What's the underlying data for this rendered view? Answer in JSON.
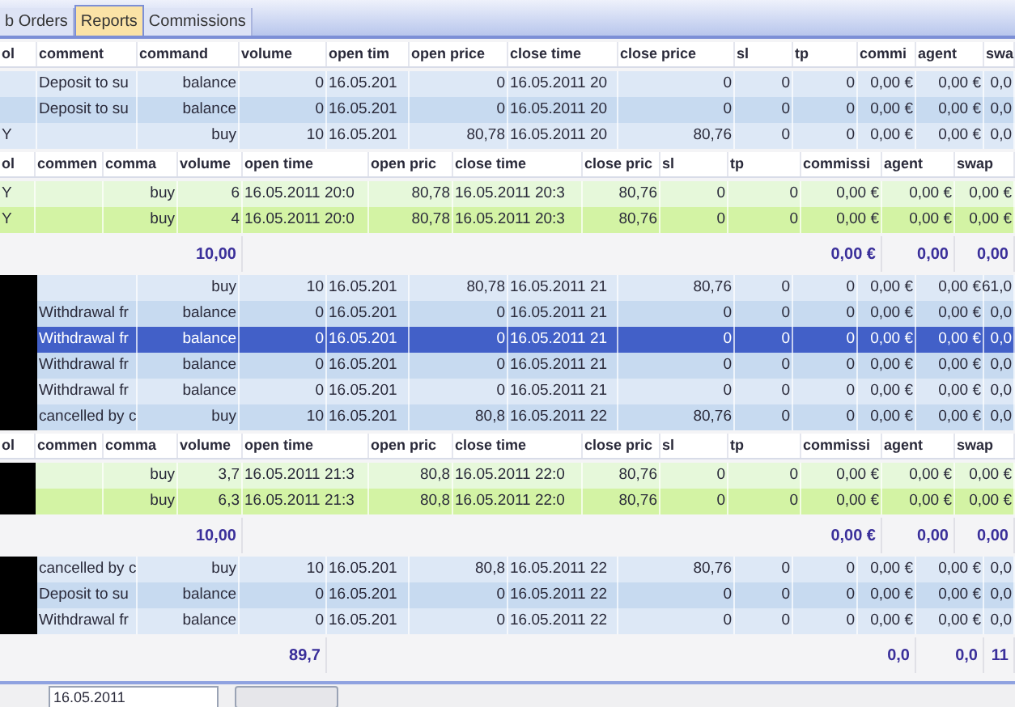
{
  "tabs": [
    {
      "label": "b Orders",
      "selected": false
    },
    {
      "label": "Reports",
      "selected": true
    },
    {
      "label": "Commissions",
      "selected": false
    }
  ],
  "blocks": [
    {
      "kind": "main_header",
      "cells": [
        "ol",
        "comment",
        "command",
        "volume",
        "open tim",
        "open price",
        "close time",
        "close price",
        "sl",
        "tp",
        "commi",
        "agent",
        "swa"
      ]
    },
    {
      "kind": "main_rows",
      "rows": [
        {
          "selected": false,
          "symbol_hidden": false,
          "cells": [
            null,
            "Deposit to su",
            "balance",
            "0",
            "16.05.201",
            "0",
            "16.05.2011 20",
            "0",
            "0",
            "0",
            "0,00 €",
            "0,00 €",
            "0,0"
          ]
        },
        {
          "selected": false,
          "symbol_hidden": false,
          "cells": [
            null,
            "Deposit to su",
            "balance",
            "0",
            "16.05.201",
            "0",
            "16.05.2011 20",
            "0",
            "0",
            "0",
            "0,00 €",
            "0,00 €",
            "0,0"
          ]
        },
        {
          "selected": false,
          "symbol_hidden": false,
          "cells": [
            "Y",
            null,
            "buy",
            "10",
            "16.05.201",
            "80,78",
            "16.05.2011 20",
            "80,76",
            "0",
            "0",
            "0,00 €",
            "0,00 €",
            "0,0"
          ]
        }
      ]
    },
    {
      "kind": "detail_header",
      "cells": [
        "ol",
        "commen",
        "comma",
        "volume",
        "open time",
        "open pric",
        "close time",
        "close pric",
        "sl",
        "tp",
        "commissi",
        "agent",
        "swap"
      ]
    },
    {
      "kind": "detail_rows",
      "rows": [
        {
          "symbol_hidden": false,
          "cells": [
            "Y",
            null,
            "buy",
            "6",
            "16.05.2011 20:0",
            "80,78",
            "16.05.2011 20:3",
            "80,76",
            "0",
            "0",
            "0,00 €",
            "0,00 €",
            "0,00 €"
          ]
        },
        {
          "symbol_hidden": false,
          "cells": [
            "Y",
            null,
            "buy",
            "4",
            "16.05.2011 20:0",
            "80,78",
            "16.05.2011 20:3",
            "80,76",
            "0",
            "0",
            "0,00 €",
            "0,00 €",
            "0,00 €"
          ]
        }
      ]
    },
    {
      "kind": "detail_total",
      "cells": [
        null,
        null,
        null,
        "10,00",
        null,
        null,
        null,
        null,
        null,
        null,
        "0,00 €",
        "0,00",
        "0,00"
      ]
    },
    {
      "kind": "main_rows",
      "rows": [
        {
          "selected": false,
          "symbol_hidden": true,
          "cells": [
            null,
            null,
            "buy",
            "10",
            "16.05.201",
            "80,78",
            "16.05.2011 21",
            "80,76",
            "0",
            "0",
            "0,00 €",
            "0,00 €",
            "61,0"
          ]
        },
        {
          "selected": false,
          "symbol_hidden": true,
          "cells": [
            null,
            "Withdrawal fr",
            "balance",
            "0",
            "16.05.201",
            "0",
            "16.05.2011 21",
            "0",
            "0",
            "0",
            "0,00 €",
            "0,00 €",
            "0,0"
          ]
        },
        {
          "selected": true,
          "symbol_hidden": true,
          "cells": [
            null,
            "Withdrawal fr",
            "balance",
            "0",
            "16.05.201",
            "0",
            "16.05.2011 21",
            "0",
            "0",
            "0",
            "0,00 €",
            "0,00 €",
            "0,0"
          ]
        },
        {
          "selected": false,
          "symbol_hidden": true,
          "cells": [
            null,
            "Withdrawal fr",
            "balance",
            "0",
            "16.05.201",
            "0",
            "16.05.2011 21",
            "0",
            "0",
            "0",
            "0,00 €",
            "0,00 €",
            "0,0"
          ]
        },
        {
          "selected": false,
          "symbol_hidden": true,
          "cells": [
            null,
            "Withdrawal fr",
            "balance",
            "0",
            "16.05.201",
            "0",
            "16.05.2011 21",
            "0",
            "0",
            "0",
            "0,00 €",
            "0,00 €",
            "0,0"
          ]
        },
        {
          "selected": false,
          "symbol_hidden": true,
          "cells": [
            null,
            "cancelled by c",
            "buy",
            "10",
            "16.05.201",
            "80,8",
            "16.05.2011 22",
            "80,76",
            "0",
            "0",
            "0,00 €",
            "0,00 €",
            "0,0"
          ]
        }
      ]
    },
    {
      "kind": "detail_header",
      "cells": [
        "ol",
        "commen",
        "comma",
        "volume",
        "open time",
        "open pric",
        "close time",
        "close pric",
        "sl",
        "tp",
        "commissi",
        "agent",
        "swap"
      ]
    },
    {
      "kind": "detail_rows",
      "rows": [
        {
          "symbol_hidden": true,
          "cells": [
            null,
            null,
            "buy",
            "3,7",
            "16.05.2011 21:3",
            "80,8",
            "16.05.2011 22:0",
            "80,76",
            "0",
            "0",
            "0,00 €",
            "0,00 €",
            "0,00 €"
          ]
        },
        {
          "symbol_hidden": true,
          "cells": [
            null,
            null,
            "buy",
            "6,3",
            "16.05.2011 21:3",
            "80,8",
            "16.05.2011 22:0",
            "80,76",
            "0",
            "0",
            "0,00 €",
            "0,00 €",
            "0,00 €"
          ]
        }
      ]
    },
    {
      "kind": "detail_total",
      "cells": [
        null,
        null,
        null,
        "10,00",
        null,
        null,
        null,
        null,
        null,
        null,
        "0,00 €",
        "0,00",
        "0,00"
      ]
    },
    {
      "kind": "main_rows",
      "rows": [
        {
          "selected": false,
          "symbol_hidden": true,
          "cells": [
            null,
            "cancelled by c",
            "buy",
            "10",
            "16.05.201",
            "80,8",
            "16.05.2011 22",
            "80,76",
            "0",
            "0",
            "0,00 €",
            "0,00 €",
            "0,0"
          ]
        },
        {
          "selected": false,
          "symbol_hidden": true,
          "cells": [
            null,
            "Deposit to su",
            "balance",
            "0",
            "16.05.201",
            "0",
            "16.05.2011 22",
            "0",
            "0",
            "0",
            "0,00 €",
            "0,00 €",
            "0,0"
          ]
        },
        {
          "selected": false,
          "symbol_hidden": true,
          "cells": [
            null,
            "Withdrawal fr",
            "balance",
            "0",
            "16.05.201",
            "0",
            "16.05.2011 22",
            "0",
            "0",
            "0",
            "0,00 €",
            "0,00 €",
            "0,0"
          ]
        }
      ]
    },
    {
      "kind": "main_total",
      "cells": [
        null,
        null,
        null,
        "89,7",
        null,
        null,
        null,
        null,
        null,
        null,
        "0,0",
        "0,0",
        "11"
      ]
    }
  ],
  "footer": {
    "date_field": "16.05.2011"
  }
}
